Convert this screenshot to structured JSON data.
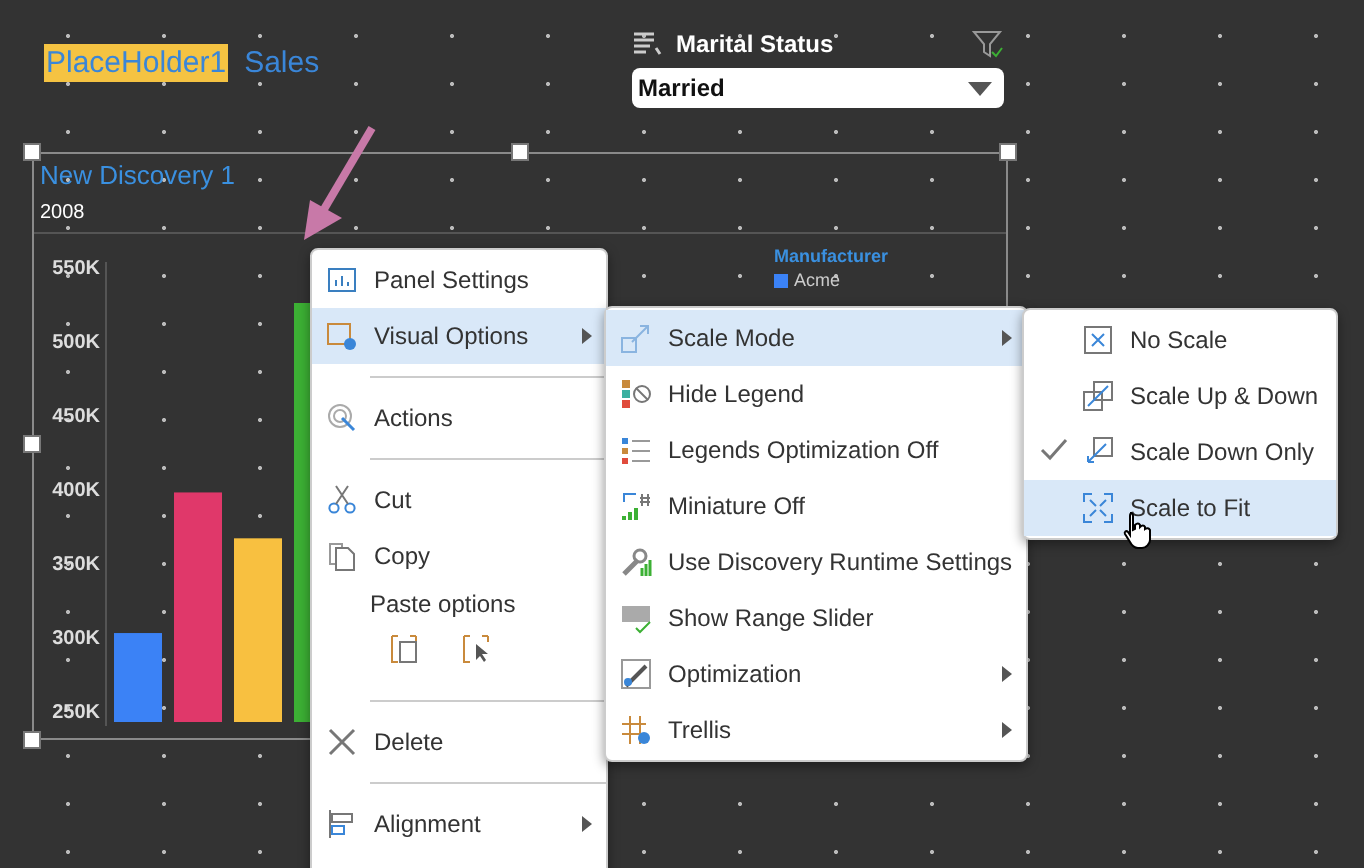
{
  "header": {
    "placeholder_tag": "PlaceHolder1",
    "title": "Sales"
  },
  "filter": {
    "label": "Marital Status",
    "value": "Married"
  },
  "panel": {
    "title": "New Discovery 1",
    "subtitle": "2008",
    "legend": {
      "title": "Manufacturer"
    },
    "chart_data": {
      "type": "bar",
      "ylim": [
        250000,
        550000
      ],
      "yticks": [
        {
          "value": 250000,
          "label": "250K"
        },
        {
          "value": 300000,
          "label": "300K"
        },
        {
          "value": 350000,
          "label": "350K"
        },
        {
          "value": 400000,
          "label": "400K"
        },
        {
          "value": 450000,
          "label": "450K"
        },
        {
          "value": 500000,
          "label": "500K"
        },
        {
          "value": 550000,
          "label": "550K"
        }
      ],
      "series": [
        {
          "name": "Acme",
          "color": "#3b82f6",
          "values": [
            302000
          ]
        },
        {
          "color": "#e0386a",
          "values": [
            397000
          ]
        },
        {
          "color": "#f8c040",
          "values": [
            366000
          ]
        },
        {
          "color": "#3cb034",
          "values": [
            525000
          ]
        }
      ]
    }
  },
  "context_menu": [
    {
      "kind": "item",
      "label": "Panel Settings",
      "selected": false,
      "submenu": false
    },
    {
      "kind": "item",
      "label": "Visual Options",
      "selected": true,
      "submenu": true
    },
    {
      "kind": "separator"
    },
    {
      "kind": "item",
      "label": "Actions",
      "selected": false,
      "submenu": false
    },
    {
      "kind": "separator"
    },
    {
      "kind": "item",
      "label": "Cut",
      "selected": false,
      "submenu": false
    },
    {
      "kind": "item",
      "label": "Copy",
      "selected": false,
      "submenu": false
    },
    {
      "kind": "paste",
      "label": "Paste options"
    },
    {
      "kind": "separator"
    },
    {
      "kind": "item",
      "label": "Delete",
      "selected": false,
      "submenu": false
    },
    {
      "kind": "separator"
    },
    {
      "kind": "item",
      "label": "Alignment",
      "selected": false,
      "submenu": true
    }
  ],
  "visual_options_menu": [
    {
      "label": "Scale Mode",
      "selected": true,
      "submenu": true
    },
    {
      "label": "Hide Legend",
      "selected": false,
      "submenu": false
    },
    {
      "label": "Legends Optimization Off",
      "selected": false,
      "submenu": false
    },
    {
      "label": "Miniature Off",
      "selected": false,
      "submenu": false
    },
    {
      "label": "Use Discovery Runtime Settings",
      "selected": false,
      "submenu": false
    },
    {
      "label": "Show Range Slider",
      "selected": false,
      "submenu": false
    },
    {
      "label": "Optimization",
      "selected": false,
      "submenu": true
    },
    {
      "label": "Trellis",
      "selected": false,
      "submenu": true
    }
  ],
  "scale_mode_menu": [
    {
      "label": "No Scale",
      "selected": false,
      "checked": false
    },
    {
      "label": "Scale Up & Down",
      "selected": false,
      "checked": false
    },
    {
      "label": "Scale Down Only",
      "selected": false,
      "checked": true
    },
    {
      "label": "Scale to Fit",
      "selected": true,
      "checked": false
    }
  ]
}
